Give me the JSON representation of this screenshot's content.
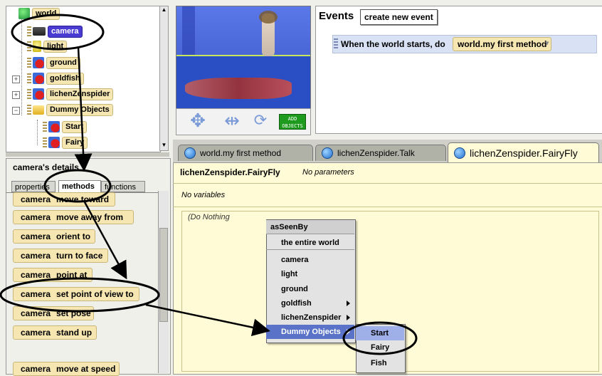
{
  "tree": {
    "items": [
      {
        "label": "world"
      },
      {
        "label": "camera"
      },
      {
        "label": "light"
      },
      {
        "label": "ground"
      },
      {
        "label": "goldfish"
      },
      {
        "label": "lichenZenspider"
      },
      {
        "label": "Dummy Objects"
      },
      {
        "label": "Start"
      },
      {
        "label": "Fairy"
      }
    ]
  },
  "world_view": {
    "add_objects_line1": "ADD",
    "add_objects_line2": "OBJECTS"
  },
  "events": {
    "title": "Events",
    "create_button": "create new event",
    "rows": [
      {
        "text": "When the world starts,  do",
        "method": "world.my first method"
      }
    ]
  },
  "details": {
    "title": "camera's details",
    "tabs": [
      "properties",
      "methods",
      "functions"
    ],
    "active_tab": "methods",
    "methods": [
      {
        "obj": "camera",
        "name": "move  toward"
      },
      {
        "obj": "camera",
        "name": "move  away from"
      },
      {
        "obj": "camera",
        "name": "orient to"
      },
      {
        "obj": "camera",
        "name": "turn to face"
      },
      {
        "obj": "camera",
        "name": "point at"
      },
      {
        "obj": "camera",
        "name": "set point of view to"
      },
      {
        "obj": "camera",
        "name": "set pose"
      },
      {
        "obj": "camera",
        "name": "stand up"
      },
      {
        "obj": "camera",
        "name": "move at speed"
      }
    ]
  },
  "editor": {
    "tabs": [
      "world.my first method",
      "lichenZenspider.Talk",
      "lichenZenspider.FairyFly"
    ],
    "active_tab": "lichenZenspider.FairyFly",
    "method_title": "lichenZenspider.FairyFly",
    "params": "No parameters",
    "vars": "No variables",
    "body": "(Do Nothing"
  },
  "popup_menu": {
    "header": "asSeenBy",
    "items": [
      "the entire world",
      "camera",
      "light",
      "ground",
      "goldfish",
      "lichenZenspider",
      "Dummy Objects"
    ],
    "submenu_items": [
      "Start",
      "Fairy",
      "Fish"
    ]
  },
  "colors": {
    "tile": "#f5e6b2",
    "selection": "#4a3bd1",
    "menu_highlight": "#5a73c8"
  }
}
